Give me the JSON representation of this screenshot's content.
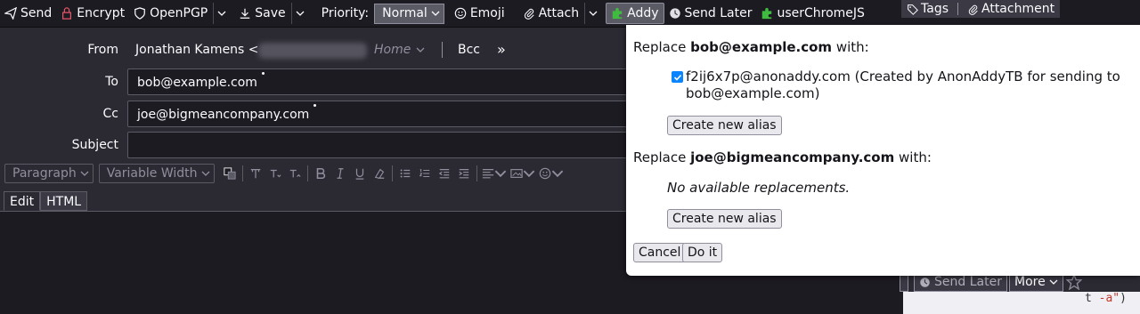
{
  "toolbar": {
    "send": "Send",
    "encrypt": "Encrypt",
    "openpgp": "OpenPGP",
    "save": "Save",
    "priority_label": "Priority:",
    "priority_value": "Normal",
    "emoji": "Emoji",
    "attach": "Attach",
    "addy": "Addy",
    "send_later": "Send Later",
    "userchromejs": "userChromeJS",
    "tags": "Tags",
    "attachment": "Attachment"
  },
  "header": {
    "from_label": "From",
    "from_name": "Jonathan Kamens <",
    "from_identity": "Home",
    "bcc": "Bcc",
    "more": "»",
    "to_label": "To",
    "to_value": "bob@example.com",
    "cc_label": "Cc",
    "cc_value": "joe@bigmeancompany.com",
    "subject_label": "Subject",
    "subject_value": ""
  },
  "format": {
    "paragraph": "Paragraph",
    "width": "Variable Width"
  },
  "tabs": {
    "edit": "Edit",
    "html": "HTML"
  },
  "background": {
    "send_later": "Send Later",
    "more": "More",
    "code_t": "t ",
    "code_arg": "-a\"",
    "code_close": ")"
  },
  "popup": {
    "replace1_prefix": "Replace ",
    "replace1_email": "bob@example.com",
    "replace1_suffix": " with:",
    "option1_text": "f2ij6x7p@anonaddy.com (Created by AnonAddyTB for sending to bob@example.com)",
    "option1_checked": true,
    "create_alias_1": "Create new alias",
    "replace2_prefix": "Replace ",
    "replace2_email": "joe@bigmeancompany.com",
    "replace2_suffix": " with:",
    "no_replacements": "No available replacements.",
    "create_alias_2": "Create new alias",
    "cancel": "Cancel",
    "do_it": "Do it"
  }
}
